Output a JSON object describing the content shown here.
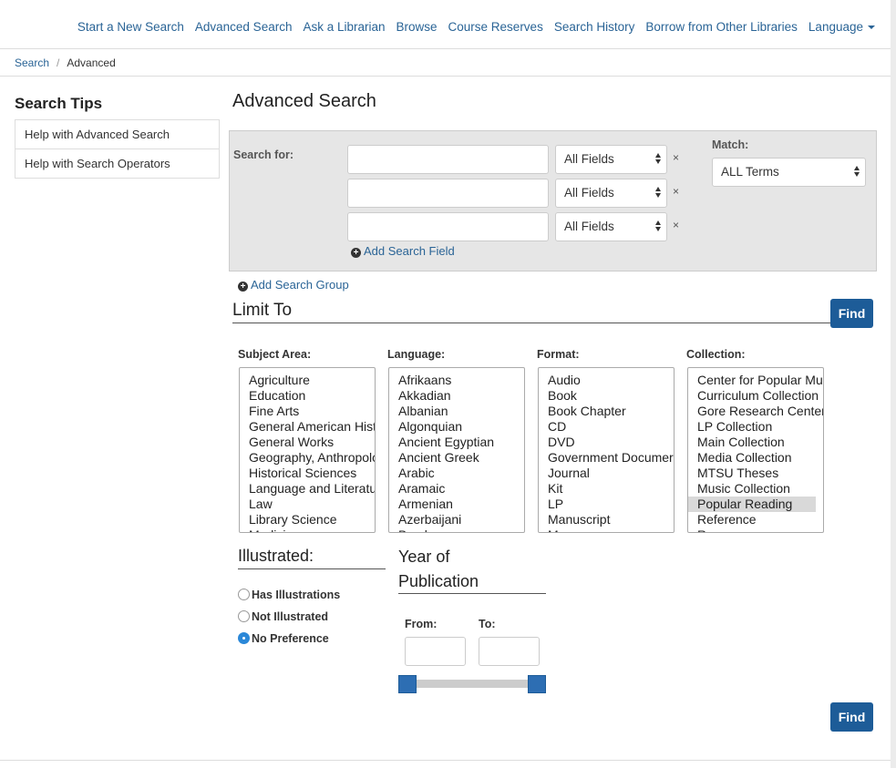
{
  "nav": {
    "links": [
      "Start a New Search",
      "Advanced Search",
      "Ask a Librarian",
      "Browse",
      "Course Reserves",
      "Search History",
      "Borrow from Other Libraries",
      "Language"
    ]
  },
  "breadcrumb": {
    "home": "Search",
    "separator": "/",
    "current": "Advanced"
  },
  "sidebar": {
    "title": "Search Tips",
    "items": [
      "Help with Advanced Search",
      "Help with Search Operators"
    ]
  },
  "main": {
    "title": "Advanced Search",
    "search_for_label": "Search for:",
    "rows": [
      {
        "value": "",
        "field": "All Fields",
        "remove": "×"
      },
      {
        "value": "",
        "field": "All Fields",
        "remove": "×"
      },
      {
        "value": "",
        "field": "All Fields",
        "remove": "×"
      }
    ],
    "match_label": "Match:",
    "match_value": "ALL Terms",
    "add_field": "Add Search Field",
    "add_group": "Add Search Group"
  },
  "limit": {
    "title": "Limit To",
    "find_label": "Find",
    "facets": [
      {
        "label": "Subject Area:",
        "options": [
          "Agriculture",
          "Education",
          "Fine Arts",
          "General American Hist",
          "General Works",
          "Geography, Anthropolo",
          "Historical Sciences",
          "Language and Literatu",
          "Law",
          "Library Science",
          "Medicine"
        ],
        "selected": -1
      },
      {
        "label": "Language:",
        "options": [
          "Afrikaans",
          "Akkadian",
          "Albanian",
          "Algonquian",
          "Ancient Egyptian",
          "Ancient Greek",
          "Arabic",
          "Aramaic",
          "Armenian",
          "Azerbaijani",
          "Bambara"
        ],
        "selected": -1
      },
      {
        "label": "Format:",
        "options": [
          "Audio",
          "Book",
          "Book Chapter",
          "CD",
          "DVD",
          "Government Documer",
          "Journal",
          "Kit",
          "LP",
          "Manuscript",
          "Map"
        ],
        "selected": -1
      },
      {
        "label": "Collection:",
        "options": [
          "Center for Popular Mu",
          "Curriculum Collection",
          "Gore Research Center",
          "LP Collection",
          "Main Collection",
          "Media Collection",
          "MTSU Theses",
          "Music Collection",
          "Popular Reading",
          "Reference",
          "Reserve"
        ],
        "selected": 8
      }
    ]
  },
  "illustrated": {
    "title": "Illustrated:",
    "options": [
      "Has Illustrations",
      "Not Illustrated",
      "No Preference"
    ],
    "selected": 2
  },
  "year": {
    "title_line1": "Year of",
    "title_line2": "Publication",
    "from_label": "From:",
    "to_label": "To:",
    "from_value": "",
    "to_value": ""
  },
  "colors": {
    "link": "#2a6496",
    "button": "#1d5c98",
    "panel": "#e6e6e6",
    "radio_selected": "#2b88d8"
  }
}
